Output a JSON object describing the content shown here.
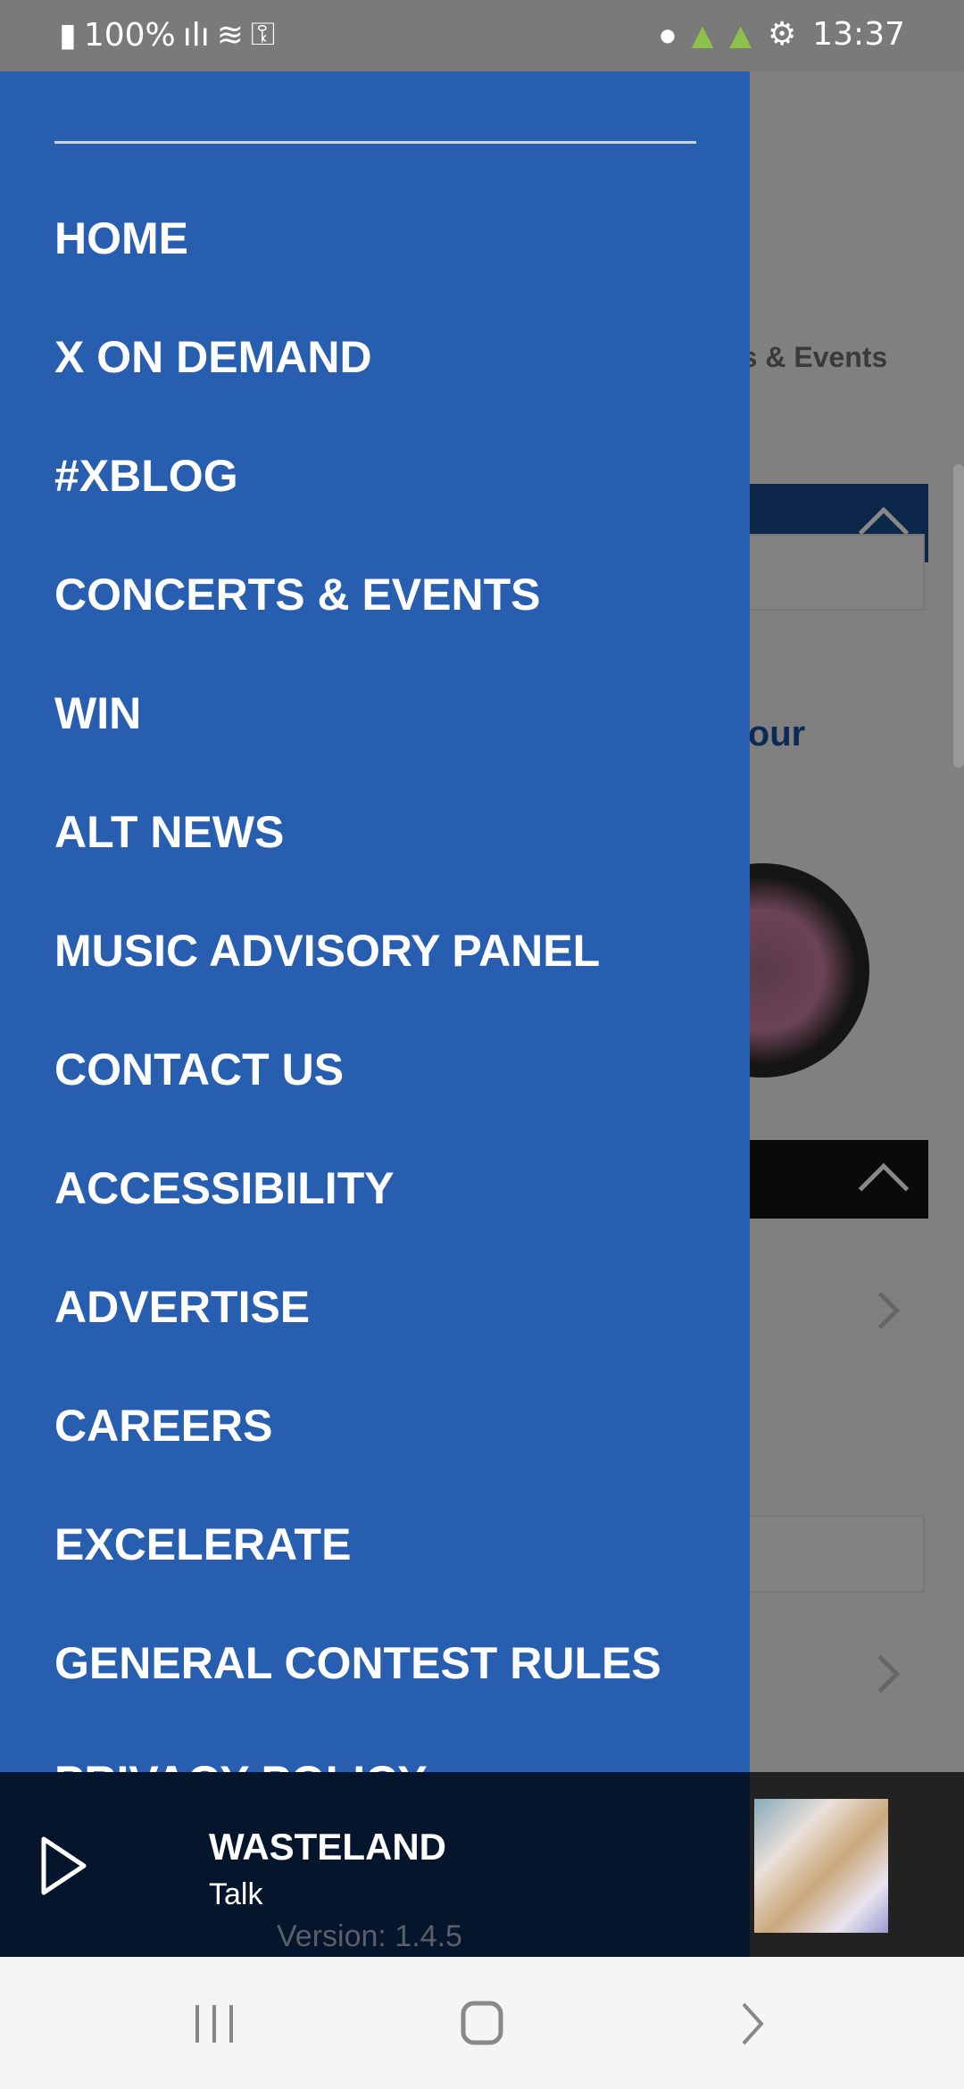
{
  "status_bar": {
    "battery": "100%",
    "time": "13:37"
  },
  "background_page": {
    "visible_text_1": "ts & Events",
    "visible_text_2": "ch our"
  },
  "drawer": {
    "items": [
      {
        "label": "HOME"
      },
      {
        "label": "X ON DEMAND"
      },
      {
        "label": "#XBLOG"
      },
      {
        "label": "CONCERTS & EVENTS"
      },
      {
        "label": "WIN"
      },
      {
        "label": "ALT NEWS"
      },
      {
        "label": "MUSIC ADVISORY PANEL"
      },
      {
        "label": "CONTACT US"
      },
      {
        "label": "ACCESSIBILITY"
      },
      {
        "label": "ADVERTISE"
      },
      {
        "label": "CAREERS"
      },
      {
        "label": "EXCELERATE"
      },
      {
        "label": "GENERAL CONTEST RULES"
      },
      {
        "label": "PRIVACY POLICY"
      }
    ],
    "version": "Version: 1.4.5",
    "background_color": "#275eb0"
  },
  "player": {
    "title": "WASTELAND",
    "subtitle": "Talk",
    "play_icon": "play-icon"
  }
}
